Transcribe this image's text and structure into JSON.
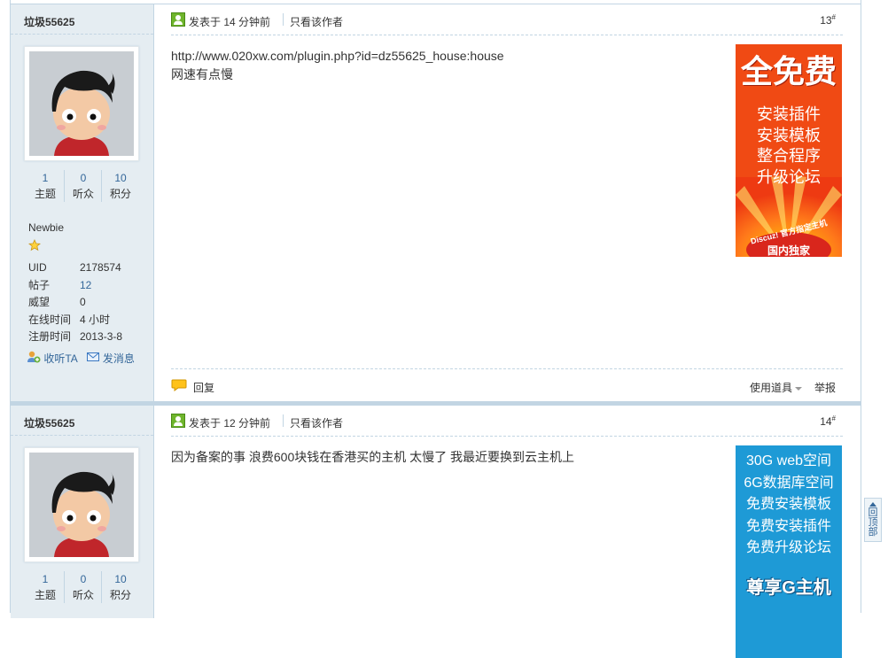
{
  "posts": [
    {
      "username": "垃圾55625",
      "stats": [
        {
          "num": "1",
          "label": "主题"
        },
        {
          "num": "0",
          "label": "听众"
        },
        {
          "num": "10",
          "label": "积分"
        }
      ],
      "rank": "Newbie",
      "info": [
        {
          "k": "UID",
          "v": "2178574"
        },
        {
          "k": "帖子",
          "v": "12"
        },
        {
          "k": "威望",
          "v": "0"
        },
        {
          "k": "在线时间",
          "v": "4 小时"
        },
        {
          "k": "注册时间",
          "v": "2013-3-8"
        }
      ],
      "follow_label": "收听TA",
      "message_label": "发消息",
      "posted": "发表于 14 分钟前",
      "author_only": "只看该作者",
      "floor": "13",
      "floor_sup": "#",
      "content_line1": "http://www.020xw.com/plugin.php?id=dz55625_house:house",
      "content_line2": "网速有点慢",
      "ad": {
        "headline": "全免费",
        "lines": [
          "安装插件",
          "安装模板",
          "整合程序",
          "升级论坛"
        ],
        "badge": "Discuz! 官方指定主机",
        "tag": "国内独家"
      },
      "reply_label": "回复",
      "tools_label": "使用道具",
      "report_label": "举报"
    },
    {
      "username": "垃圾55625",
      "stats": [
        {
          "num": "1",
          "label": "主题"
        },
        {
          "num": "0",
          "label": "听众"
        },
        {
          "num": "10",
          "label": "积分"
        }
      ],
      "posted": "发表于 12 分钟前",
      "author_only": "只看该作者",
      "floor": "14",
      "floor_sup": "#",
      "content_line1": "因为备案的事 浪费600块钱在香港买的主机 太慢了 我最近要换到云主机上",
      "ad": {
        "lines": [
          "30G web空间",
          "6G数据库空间",
          "免费安装模板",
          "免费安装插件",
          "免费升级论坛"
        ],
        "brand": "尊享G主机"
      }
    }
  ],
  "back_to_top": "回顶部",
  "colors": {
    "sidebar_bg": "#e5edf2",
    "border": "#c2d5e3",
    "link": "#336699",
    "ad1_bg": "#f04a14",
    "ad2_bg": "#1e9ad6"
  },
  "icons": [
    "online-user-icon",
    "reply-bubble-icon",
    "star-icon",
    "follow-icon",
    "mail-icon",
    "avatar-image"
  ]
}
